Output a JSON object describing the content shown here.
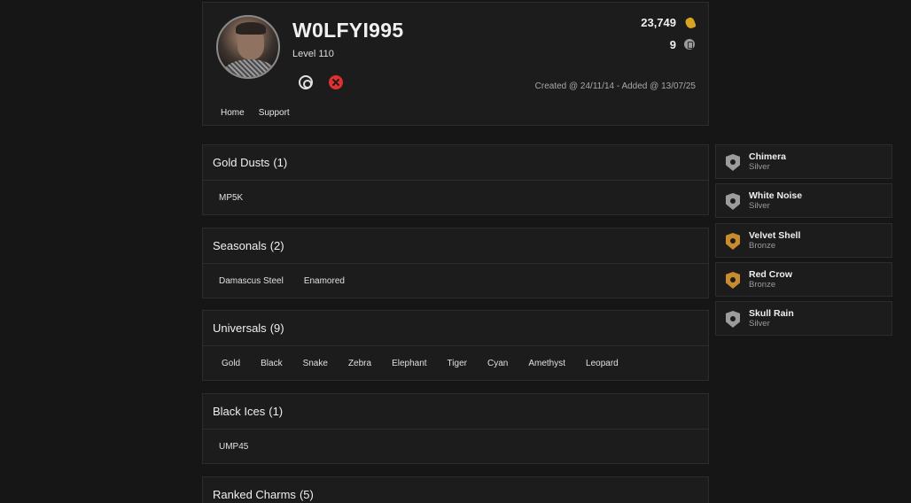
{
  "profile": {
    "username": "W0LFYI995",
    "level": "Level 110",
    "renown": "23,749",
    "credits": "9",
    "dates": "Created @ 24/11/14 - Added @ 13/07/25",
    "platforms": [
      "ubisoft-icon",
      "xbox-icon"
    ],
    "nav": [
      "Home",
      "Support"
    ]
  },
  "sections": [
    {
      "title": "Gold Dusts",
      "count": "(1)",
      "items": [
        "MP5K"
      ]
    },
    {
      "title": "Seasonals",
      "count": "(2)",
      "items": [
        "Damascus Steel",
        "Enamored"
      ]
    },
    {
      "title": "Universals",
      "count": "(9)",
      "items": [
        "Gold",
        "Black",
        "Snake",
        "Zebra",
        "Elephant",
        "Tiger",
        "Cyan",
        "Amethyst",
        "Leopard"
      ]
    },
    {
      "title": "Black Ices",
      "count": "(1)",
      "items": [
        "UMP45"
      ]
    },
    {
      "title": "Ranked Charms",
      "count": "(5)",
      "items": []
    }
  ],
  "charms": [
    {
      "name": "Chimera",
      "tier": "Silver"
    },
    {
      "name": "White Noise",
      "tier": "Silver"
    },
    {
      "name": "Velvet Shell",
      "tier": "Bronze"
    },
    {
      "name": "Red Crow",
      "tier": "Bronze"
    },
    {
      "name": "Skull Rain",
      "tier": "Silver"
    }
  ],
  "colors": {
    "background": "#161616",
    "card": "#1c1c1c",
    "border": "#2c2c2c",
    "renown": "#d9a520",
    "xbox": "#e03030",
    "bronze": "#c98c2c",
    "silver": "#9c9c9c"
  }
}
